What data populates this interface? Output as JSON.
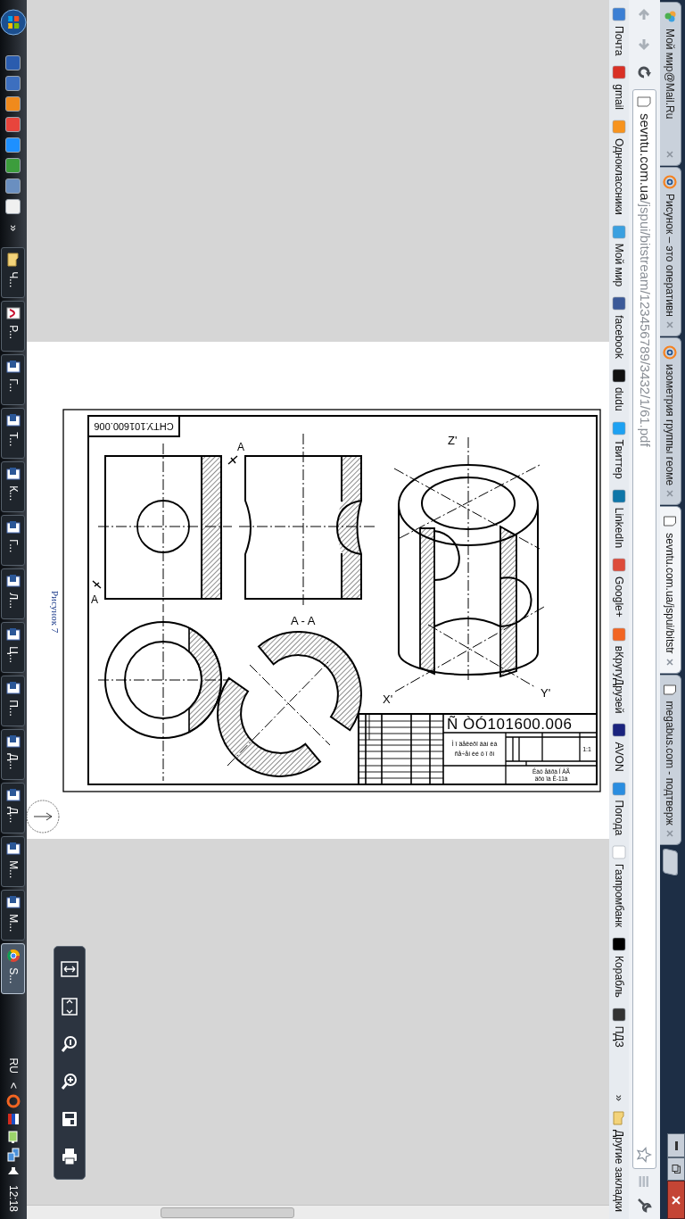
{
  "browser": {
    "tabs": [
      {
        "title": "Мой мир@Mail.Ru",
        "kind": "people",
        "selected": false
      },
      {
        "title": "Рисунок – это оперативн",
        "kind": "at",
        "selected": false
      },
      {
        "title": "изометрия группы геоме",
        "kind": "at",
        "selected": false
      },
      {
        "title": "sevntu.com.ua/jspui/bitstr",
        "kind": "page",
        "selected": true
      },
      {
        "title": "megabus.com - подтверж",
        "kind": "page",
        "selected": false
      }
    ],
    "address": {
      "host": "sevntu.com.ua",
      "path": "/jspui/bitstream/123456789/3432/1/61.pdf"
    },
    "bookmarks": [
      {
        "label": "Почта",
        "color": "#3b7fd4"
      },
      {
        "label": "gmail",
        "color": "#d93025"
      },
      {
        "label": "Одноклассники",
        "color": "#f7931e"
      },
      {
        "label": "Мой мир",
        "color": "#3aa0e0"
      },
      {
        "label": "facebook",
        "color": "#3b5998"
      },
      {
        "label": "dudu",
        "color": "#111111"
      },
      {
        "label": "Твиттер",
        "color": "#1da1f2"
      },
      {
        "label": "LinkedIn",
        "color": "#0e76a8"
      },
      {
        "label": "Google+",
        "color": "#dd4b39"
      },
      {
        "label": "вКругуДрузей",
        "color": "#f26522"
      },
      {
        "label": "AVON",
        "color": "#1a237e"
      },
      {
        "label": "Погода",
        "color": "#2a8de0"
      },
      {
        "label": "Газпромбанк",
        "color": "#ffffff"
      },
      {
        "label": "Корабль",
        "color": "#000000"
      },
      {
        "label": "ПДЗ",
        "color": "#333333"
      }
    ],
    "bookmarks_overflow": "»",
    "other_bookmarks": "Другие закладки"
  },
  "pdf": {
    "caption": "Рисунок 7",
    "drawing": {
      "stamp": "СНТУ.101600.006",
      "section_marks": [
        "A",
        "A"
      ],
      "section_title": "A - A",
      "axes": [
        "Z'",
        "X'",
        "Y'"
      ],
      "title_block": {
        "designation": "Ñ ÒÓ101600.006",
        "title_lines": [
          "Ì î äåëèðî âàí èà",
          "ñå÷åí èé ô î ðì"
        ],
        "scale": "1:1",
        "organization_lines": [
          "Êàô åäðà Í ÀÃ",
          "äðó ïà Ê-11à"
        ]
      }
    }
  },
  "taskbar": {
    "quick_launch": [
      {
        "color": "#2a5cae"
      },
      {
        "color": "#3d6fbf"
      },
      {
        "color": "#f08a1c"
      },
      {
        "color": "#e8453c"
      },
      {
        "color": "#1e90ff"
      },
      {
        "color": "#3c9d3c"
      },
      {
        "color": "#6a8fc0"
      },
      {
        "color": "#f0f0f0"
      }
    ],
    "overflow": "»",
    "tasks": [
      {
        "label": "Ч...",
        "kind": "folder",
        "selected": false
      },
      {
        "label": "Р...",
        "kind": "pdf",
        "selected": false
      },
      {
        "label": "Г...",
        "kind": "doc",
        "selected": false
      },
      {
        "label": "Т...",
        "kind": "doc",
        "selected": false
      },
      {
        "label": "К...",
        "kind": "doc",
        "selected": false
      },
      {
        "label": "Г...",
        "kind": "doc",
        "selected": false
      },
      {
        "label": "Л...",
        "kind": "doc",
        "selected": false
      },
      {
        "label": "Ц...",
        "kind": "doc",
        "selected": false
      },
      {
        "label": "П...",
        "kind": "doc",
        "selected": false
      },
      {
        "label": "Д...",
        "kind": "doc",
        "selected": false
      },
      {
        "label": "Д...",
        "kind": "doc",
        "selected": false
      },
      {
        "label": "М...",
        "kind": "doc",
        "selected": false
      },
      {
        "label": "М...",
        "kind": "doc",
        "selected": false
      },
      {
        "label": "S...",
        "kind": "chrome",
        "selected": true
      }
    ],
    "language": "RU",
    "tray_toggle": "<",
    "clock": "12:18"
  }
}
